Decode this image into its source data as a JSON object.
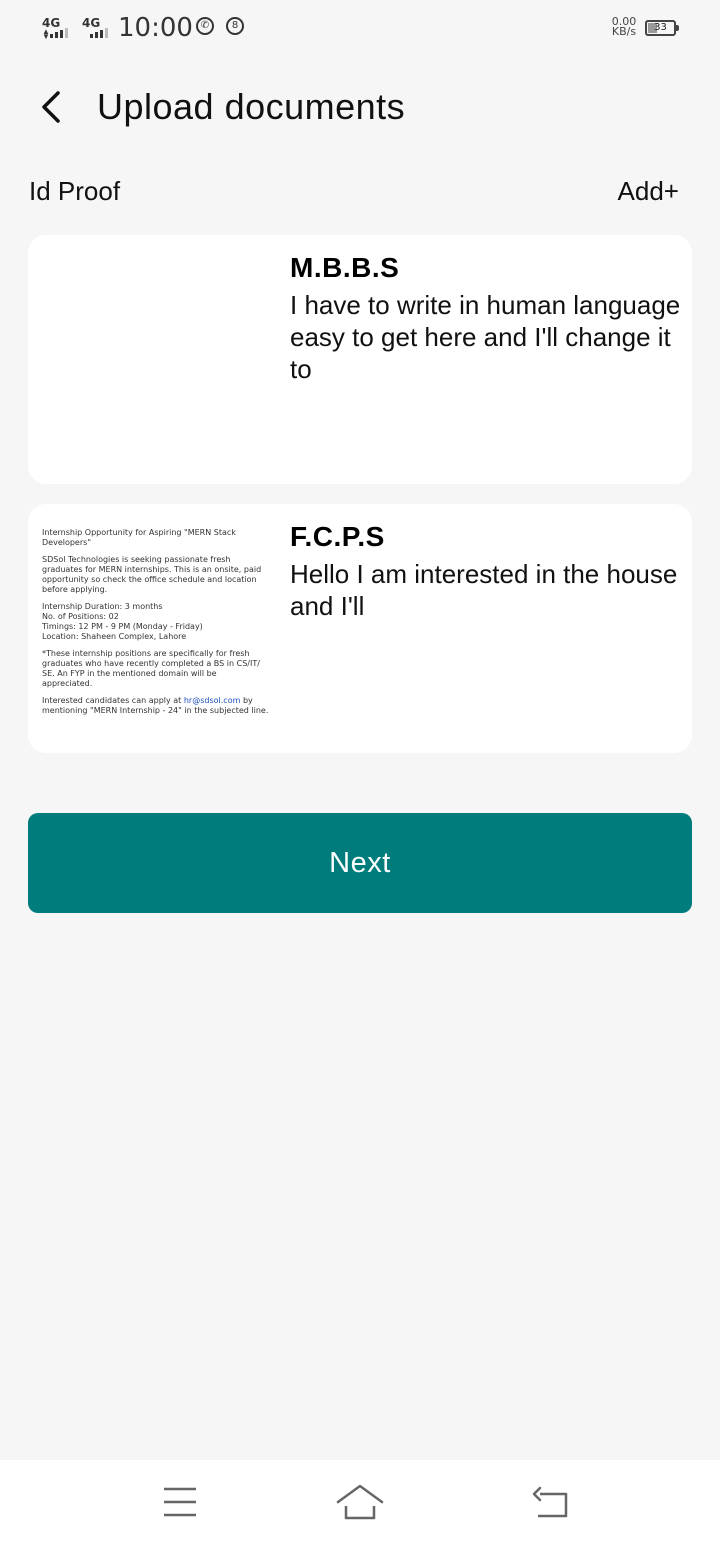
{
  "status_bar": {
    "network_1": "4G",
    "network_2": "4G",
    "time": "10:00",
    "speed_value": "0.00",
    "speed_unit": "KB/s",
    "battery_percent": "33",
    "battery_level": 0.33,
    "icons": [
      "signal-icon",
      "signal-icon",
      "whatsapp-icon",
      "notification-badge-icon",
      "battery-icon"
    ]
  },
  "header": {
    "back_icon": "chevron-left-icon",
    "title": "Upload documents"
  },
  "section": {
    "label": "Id Proof",
    "add_label": "Add+"
  },
  "documents": [
    {
      "title": "M.B.B.S",
      "description": "I have to write in human language easy to get here and I'll change it to",
      "thumbnail": {
        "lines": []
      }
    },
    {
      "title": "F.C.P.S",
      "description": "Hello I am interested in the house and I'll",
      "thumbnail": {
        "lines": [
          "Internship Opportunity for Aspiring \"MERN Stack",
          "Developers\"",
          "SDSol Technologies is seeking passionate fresh",
          "graduates for MERN internships. This is an onsite, paid",
          "opportunity so check the office schedule and location",
          "before applying.",
          "Internship Duration: 3 months",
          "No. of Positions: 02",
          "Timings: 12 PM - 9 PM (Monday - Friday)",
          "Location: Shaheen Complex, Lahore",
          "*These internship positions are specifically for fresh",
          "graduates who have recently completed a BS in CS/IT/",
          "SE. An FYP in the mentioned domain will be",
          "appreciated.",
          "Interested candidates can apply at",
          "hr@sdsol.com",
          "by",
          "mentioning \"MERN Internship - 24\" in the subjected line."
        ]
      }
    }
  ],
  "next_button": {
    "label": "Next",
    "color": "#007c7c"
  },
  "nav_bar": {
    "icons": [
      "menu-icon",
      "home-icon",
      "back-nav-icon"
    ]
  }
}
